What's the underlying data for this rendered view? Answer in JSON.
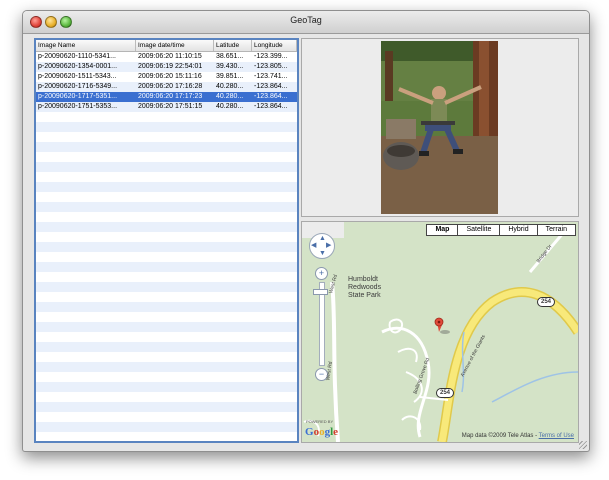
{
  "window": {
    "title": "GeoTag"
  },
  "table": {
    "columns": [
      "Image Name",
      "Image date/time",
      "Latitude",
      "Longitude"
    ],
    "rows": [
      [
        "p-20090620-1110-5341...",
        "2009:06:20 11:10:15",
        "38.651...",
        "-123.399..."
      ],
      [
        "p-20090620-1354-0001...",
        "2009:06:19 22:54:01",
        "39.430...",
        "-123.805..."
      ],
      [
        "p-20090620-1511-5343...",
        "2009:06:20 15:11:16",
        "39.851...",
        "-123.741..."
      ],
      [
        "p-20090620-1716-5349...",
        "2009:06:20 17:16:28",
        "40.280...",
        "-123.864..."
      ],
      [
        "p-20090620-1717-5351...",
        "2009:06:20 17:17:23",
        "40.280...",
        "-123.864..."
      ],
      [
        "p-20090620-1751-5353...",
        "2009:06:20 17:51:15",
        "40.280...",
        "-123.864..."
      ]
    ],
    "selected_index": 4
  },
  "map": {
    "types": [
      "Map",
      "Satellite",
      "Hybrid",
      "Terrain"
    ],
    "active_type": "Map",
    "park_label": "Humboldt\nRedwoods\nState Park",
    "route_badge": "254",
    "road_labels": [
      "Avenue of the Giants",
      "West Rd",
      "Bridge Dr",
      "Bolling Grove Rd"
    ],
    "copyright": "Map data ©2009 Tele Atlas - ",
    "terms_link": "Terms of Use",
    "powered_by": "POWERED BY",
    "logo": "Google"
  }
}
